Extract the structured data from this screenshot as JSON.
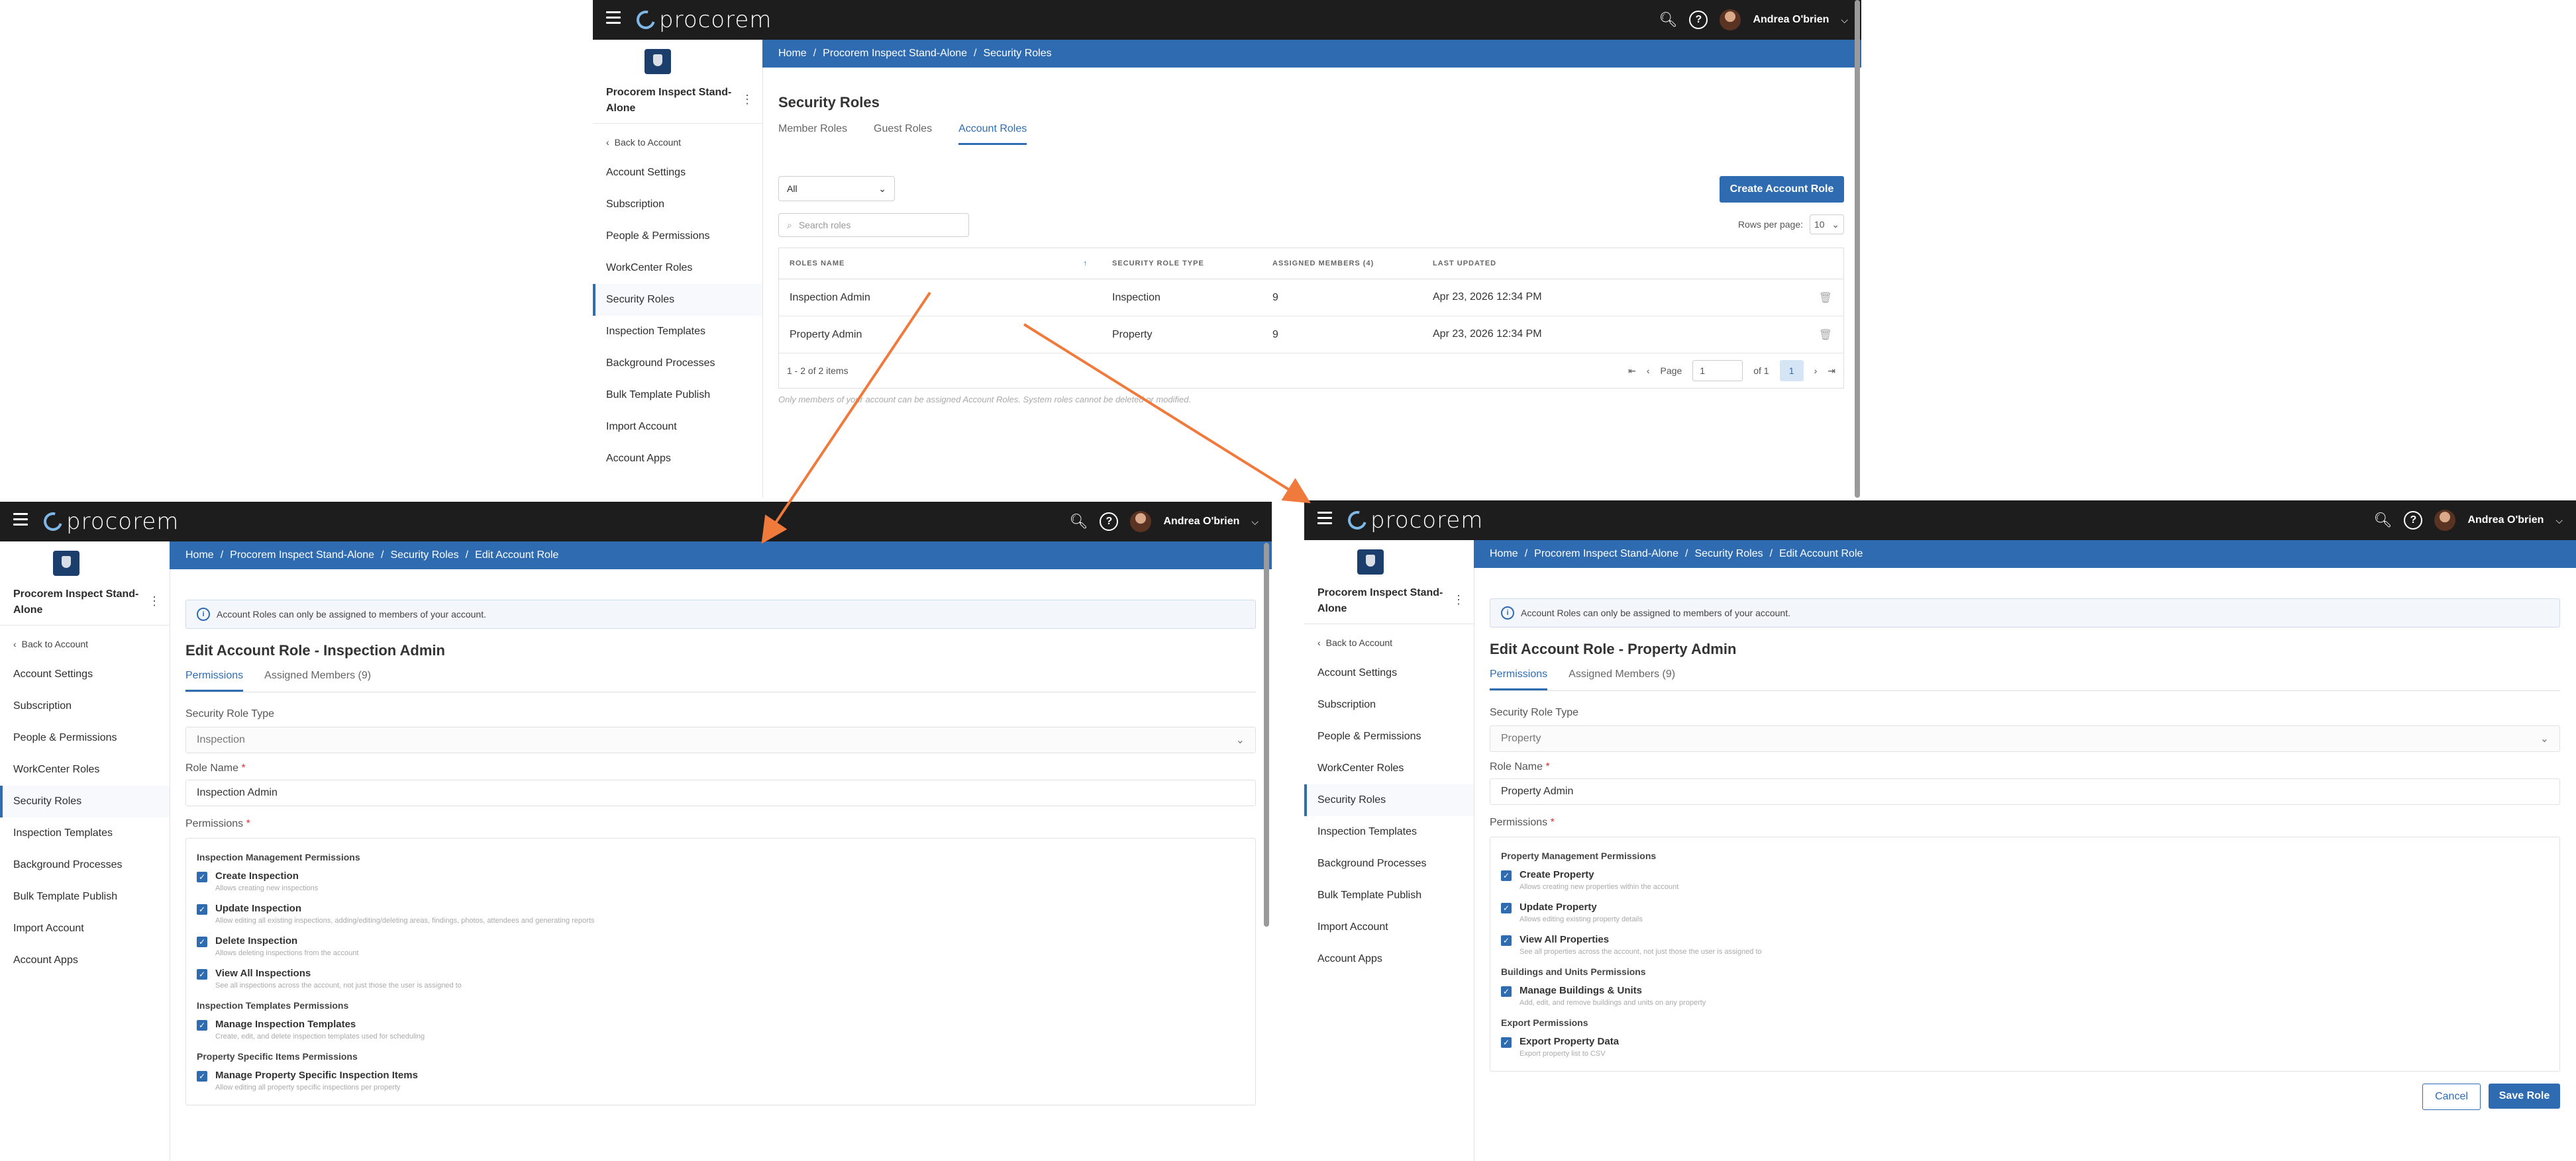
{
  "common": {
    "logo_text": "procorem",
    "user_name": "Andrea O'brien",
    "org_name": "Procorem Inspect Stand-Alone",
    "back_label": "Back to Account",
    "nav": [
      "Account Settings",
      "Subscription",
      "People & Permissions",
      "WorkCenter Roles",
      "Security Roles",
      "Inspection Templates",
      "Background Processes",
      "Bulk Template Publish",
      "Import Account",
      "Account Apps"
    ],
    "active_nav": "Security Roles"
  },
  "list_page": {
    "breadcrumb": [
      "Home",
      "Procorem Inspect Stand-Alone",
      "Security Roles"
    ],
    "title": "Security Roles",
    "tabs": [
      "Member Roles",
      "Guest Roles",
      "Account Roles"
    ],
    "active_tab": "Account Roles",
    "filter_value": "All",
    "search_placeholder": "Search roles",
    "create_button": "Create Account Role",
    "rows_per_page_label": "Rows per page:",
    "rows_per_page_value": "10",
    "columns": [
      "ROLES NAME",
      "SECURITY ROLE TYPE",
      "ASSIGNED MEMBERS (4)",
      "LAST UPDATED"
    ],
    "rows": [
      {
        "name": "Inspection Admin",
        "type": "Inspection",
        "members": "9",
        "updated": "Apr 23, 2026 12:34 PM"
      },
      {
        "name": "Property Admin",
        "type": "Property",
        "members": "9",
        "updated": "Apr 23, 2026 12:34 PM"
      }
    ],
    "item_count": "1 - 2 of 2 items",
    "page_label": "Page",
    "page_value": "1",
    "of_label": "of 1",
    "current_page": "1",
    "footnote": "Only members of your account can be assigned Account Roles. System roles cannot be deleted or modified."
  },
  "edit_inspection": {
    "breadcrumb": [
      "Home",
      "Procorem Inspect Stand-Alone",
      "Security Roles",
      "Edit Account Role"
    ],
    "info": "Account Roles can only be assigned to members of your account.",
    "title": "Edit Account Role - Inspection Admin",
    "tabs": [
      "Permissions",
      "Assigned Members (9)"
    ],
    "type_label": "Security Role Type",
    "type_value": "Inspection",
    "name_label": "Role Name",
    "name_value": "Inspection Admin",
    "perms_label": "Permissions",
    "groups": [
      {
        "title": "Inspection Management Permissions",
        "items": [
          {
            "t": "Create Inspection",
            "d": "Allows creating new inspections"
          },
          {
            "t": "Update Inspection",
            "d": "Allow editing all existing inspections, adding/editing/deleting areas, findings, photos, attendees and generating reports"
          },
          {
            "t": "Delete Inspection",
            "d": "Allows deleting inspections from the account"
          },
          {
            "t": "View All Inspections",
            "d": "See all inspections across the account, not just those the user is assigned to"
          }
        ]
      },
      {
        "title": "Inspection Templates Permissions",
        "items": [
          {
            "t": "Manage Inspection Templates",
            "d": "Create, edit, and delete inspection templates used for scheduling"
          }
        ]
      },
      {
        "title": "Property Specific Items Permissions",
        "items": [
          {
            "t": "Manage Property Specific Inspection Items",
            "d": "Allow editing all property specific inspections per property"
          }
        ]
      }
    ]
  },
  "edit_property": {
    "breadcrumb": [
      "Home",
      "Procorem Inspect Stand-Alone",
      "Security Roles",
      "Edit Account Role"
    ],
    "info": "Account Roles can only be assigned to members of your account.",
    "title": "Edit Account Role - Property Admin",
    "tabs": [
      "Permissions",
      "Assigned Members (9)"
    ],
    "type_label": "Security Role Type",
    "type_value": "Property",
    "name_label": "Role Name",
    "name_value": "Property Admin",
    "perms_label": "Permissions",
    "groups": [
      {
        "title": "Property Management Permissions",
        "items": [
          {
            "t": "Create Property",
            "d": "Allows creating new properties within the account"
          },
          {
            "t": "Update Property",
            "d": "Allows editing existing property details"
          },
          {
            "t": "View All Properties",
            "d": "See all properties across the account, not just those the user is assigned to"
          }
        ]
      },
      {
        "title": "Buildings and Units Permissions",
        "items": [
          {
            "t": "Manage Buildings & Units",
            "d": "Add, edit, and remove buildings and units on any property"
          }
        ]
      },
      {
        "title": "Export Permissions",
        "items": [
          {
            "t": "Export Property Data",
            "d": "Export property list to CSV"
          }
        ]
      }
    ],
    "cancel": "Cancel",
    "save": "Save Role"
  },
  "colors": {
    "topbar": "#1d1d1d",
    "crumb": "#2e6bb1",
    "accent": "#2e6bb1",
    "arrow": "#f07a3c"
  }
}
